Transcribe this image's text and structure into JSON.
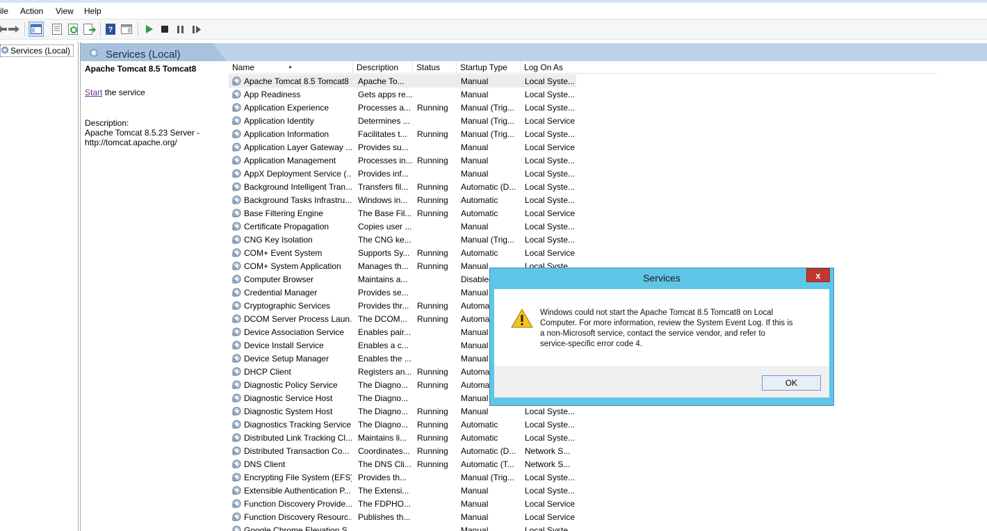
{
  "menu": [
    "ile",
    "Action",
    "View",
    "Help"
  ],
  "tree": {
    "root_label": "Services (Local)"
  },
  "panel": {
    "title": "Services (Local)"
  },
  "details": {
    "service_name": "Apache Tomcat 8.5 Tomcat8",
    "start_link": "Start",
    "start_suffix": " the service",
    "description_label": "Description:",
    "description_line1": "Apache Tomcat 8.5.23 Server -",
    "description_line2": "http://tomcat.apache.org/"
  },
  "columns": [
    "Name",
    "Description",
    "Status",
    "Startup Type",
    "Log On As"
  ],
  "services": [
    [
      "Apache Tomcat 8.5 Tomcat8",
      "Apache To...",
      "",
      "Manual",
      "Local Syste..."
    ],
    [
      "App Readiness",
      "Gets apps re...",
      "",
      "Manual",
      "Local Syste..."
    ],
    [
      "Application Experience",
      "Processes a...",
      "Running",
      "Manual (Trig...",
      "Local Syste..."
    ],
    [
      "Application Identity",
      "Determines ...",
      "",
      "Manual (Trig...",
      "Local Service"
    ],
    [
      "Application Information",
      "Facilitates t...",
      "Running",
      "Manual (Trig...",
      "Local Syste..."
    ],
    [
      "Application Layer Gateway ...",
      "Provides su...",
      "",
      "Manual",
      "Local Service"
    ],
    [
      "Application Management",
      "Processes in...",
      "Running",
      "Manual",
      "Local Syste..."
    ],
    [
      "AppX Deployment Service (...",
      "Provides inf...",
      "",
      "Manual",
      "Local Syste..."
    ],
    [
      "Background Intelligent Tran...",
      "Transfers fil...",
      "Running",
      "Automatic (D...",
      "Local Syste..."
    ],
    [
      "Background Tasks Infrastru...",
      "Windows in...",
      "Running",
      "Automatic",
      "Local Syste..."
    ],
    [
      "Base Filtering Engine",
      "The Base Fil...",
      "Running",
      "Automatic",
      "Local Service"
    ],
    [
      "Certificate Propagation",
      "Copies user ...",
      "",
      "Manual",
      "Local Syste..."
    ],
    [
      "CNG Key Isolation",
      "The CNG ke...",
      "",
      "Manual (Trig...",
      "Local Syste..."
    ],
    [
      "COM+ Event System",
      "Supports Sy...",
      "Running",
      "Automatic",
      "Local Service"
    ],
    [
      "COM+ System Application",
      "Manages th...",
      "Running",
      "Manual",
      "Local Syste..."
    ],
    [
      "Computer Browser",
      "Maintains a...",
      "",
      "Disabled",
      ""
    ],
    [
      "Credential Manager",
      "Provides se...",
      "",
      "Manual",
      ""
    ],
    [
      "Cryptographic Services",
      "Provides thr...",
      "Running",
      "Automa",
      ""
    ],
    [
      "DCOM Server Process Laun...",
      "The DCOM...",
      "Running",
      "Automa",
      ""
    ],
    [
      "Device Association Service",
      "Enables pair...",
      "",
      "Manual",
      ""
    ],
    [
      "Device Install Service",
      "Enables a c...",
      "",
      "Manual",
      ""
    ],
    [
      "Device Setup Manager",
      "Enables the ...",
      "",
      "Manual",
      ""
    ],
    [
      "DHCP Client",
      "Registers an...",
      "Running",
      "Automa",
      ""
    ],
    [
      "Diagnostic Policy Service",
      "The Diagno...",
      "Running",
      "Automa",
      ""
    ],
    [
      "Diagnostic Service Host",
      "The Diagno...",
      "",
      "Manual",
      ""
    ],
    [
      "Diagnostic System Host",
      "The Diagno...",
      "Running",
      "Manual",
      "Local Syste..."
    ],
    [
      "Diagnostics Tracking Service",
      "The Diagno...",
      "Running",
      "Automatic",
      "Local Syste..."
    ],
    [
      "Distributed Link Tracking Cl...",
      "Maintains li...",
      "Running",
      "Automatic",
      "Local Syste..."
    ],
    [
      "Distributed Transaction Co...",
      "Coordinates...",
      "Running",
      "Automatic (D...",
      "Network S..."
    ],
    [
      "DNS Client",
      "The DNS Cli...",
      "Running",
      "Automatic (T...",
      "Network S..."
    ],
    [
      "Encrypting File System (EFS)",
      "Provides th...",
      "",
      "Manual (Trig...",
      "Local Syste..."
    ],
    [
      "Extensible Authentication P...",
      "The Extensi...",
      "",
      "Manual",
      "Local Syste..."
    ],
    [
      "Function Discovery Provide...",
      "The FDPHO...",
      "",
      "Manual",
      "Local Service"
    ],
    [
      "Function Discovery Resourc...",
      "Publishes th...",
      "",
      "Manual",
      "Local Service"
    ],
    [
      "Google Chrome Elevation S...",
      "",
      "",
      "Manual",
      "Local Syste..."
    ]
  ],
  "dialog": {
    "title": "Services",
    "close_label": "x",
    "message_lines": [
      "Windows could not start the Apache Tomcat 8.5 Tomcat8 on Local",
      "Computer. For more information, review the System Event Log. If this is",
      "a non-Microsoft service, contact the service vendor, and refer to",
      "service-specific error code 4."
    ],
    "ok_label": "OK"
  },
  "colors": {
    "dialog_frame": "#5fc6e8",
    "close_button": "#c4362d",
    "header_band": "#bfd3e8"
  }
}
